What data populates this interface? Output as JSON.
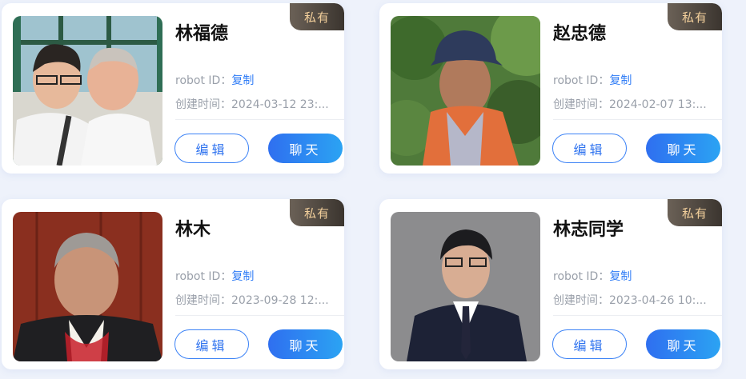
{
  "cards": [
    {
      "name": "林福德",
      "badge": "私有",
      "robot_id_label": "robot ID：",
      "copy_label": "复制",
      "created_label": "创建时间：",
      "created_time": "2024-03-12 23:...",
      "edit_label": "编辑",
      "chat_label": "聊天"
    },
    {
      "name": "赵忠德",
      "badge": "私有",
      "robot_id_label": "robot ID：",
      "copy_label": "复制",
      "created_label": "创建时间：",
      "created_time": "2024-02-07 13:...",
      "edit_label": "编辑",
      "chat_label": "聊天"
    },
    {
      "name": "林木",
      "badge": "私有",
      "robot_id_label": "robot ID：",
      "copy_label": "复制",
      "created_label": "创建时间：",
      "created_time": "2023-09-28 12:...",
      "edit_label": "编辑",
      "chat_label": "聊天"
    },
    {
      "name": "林志同学",
      "badge": "私有",
      "robot_id_label": "robot ID：",
      "copy_label": "复制",
      "created_label": "创建时间：",
      "created_time": "2023-04-26 10:...",
      "edit_label": "编辑",
      "chat_label": "聊天"
    }
  ],
  "colors": {
    "accent": "#2f7cf6",
    "badge_text": "#f2cf9b",
    "badge_bg": "#3b352f"
  }
}
